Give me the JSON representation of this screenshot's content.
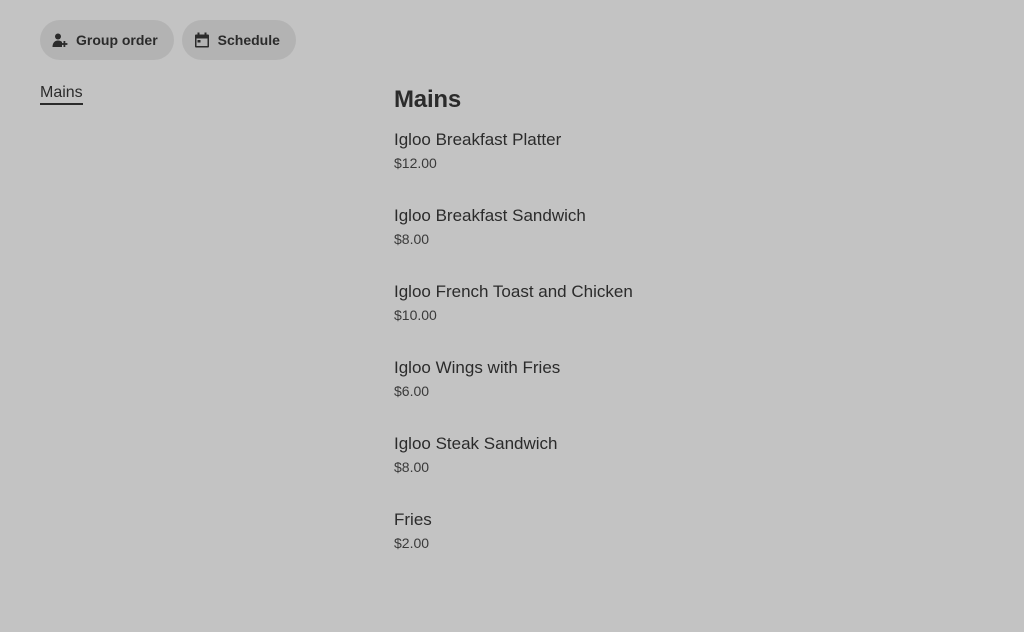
{
  "actions": {
    "group_order_label": "Group order",
    "schedule_label": "Schedule"
  },
  "nav": {
    "categories": [
      "Mains"
    ]
  },
  "section": {
    "title": "Mains",
    "items": [
      {
        "name": "Igloo Breakfast Platter",
        "price": "$12.00"
      },
      {
        "name": "Igloo Breakfast Sandwich",
        "price": "$8.00"
      },
      {
        "name": "Igloo French Toast and Chicken",
        "price": "$10.00"
      },
      {
        "name": "Igloo Wings with Fries",
        "price": "$6.00"
      },
      {
        "name": "Igloo Steak Sandwich",
        "price": "$8.00"
      },
      {
        "name": "Fries",
        "price": "$2.00"
      }
    ]
  },
  "icons": {
    "group_order": "person-add-icon",
    "schedule": "calendar-icon"
  },
  "colors": {
    "background": "#c3c3c3",
    "pill": "#b3b3b3",
    "text": "#2b2b2b"
  }
}
